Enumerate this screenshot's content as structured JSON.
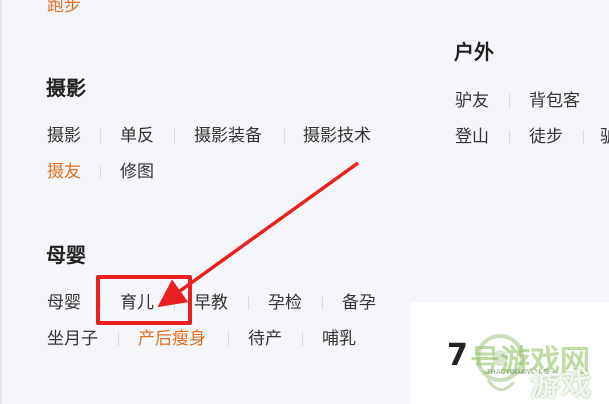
{
  "top": {
    "partial_tag": "跑步"
  },
  "photography": {
    "title": "摄影",
    "tags": [
      "摄影",
      "单反",
      "摄影装备",
      "摄影技术",
      "摄友",
      "修图"
    ]
  },
  "outdoor": {
    "title": "户外",
    "tags": [
      "驴友",
      "背包客",
      "登山",
      "徒步",
      "驴"
    ]
  },
  "baby": {
    "title": "母婴",
    "tags": [
      "母婴",
      "育儿",
      "早教",
      "孕检",
      "备孕",
      "坐月子",
      "产后瘦身",
      "待产",
      "哺乳"
    ]
  },
  "card": {
    "number": "7"
  },
  "watermark": {
    "line1": "号游戏网",
    "line2": "游戏",
    "small": "7HAOYOUXIWANG"
  },
  "colors": {
    "highlight": "#e0701e",
    "annotation": "#e8211f"
  }
}
